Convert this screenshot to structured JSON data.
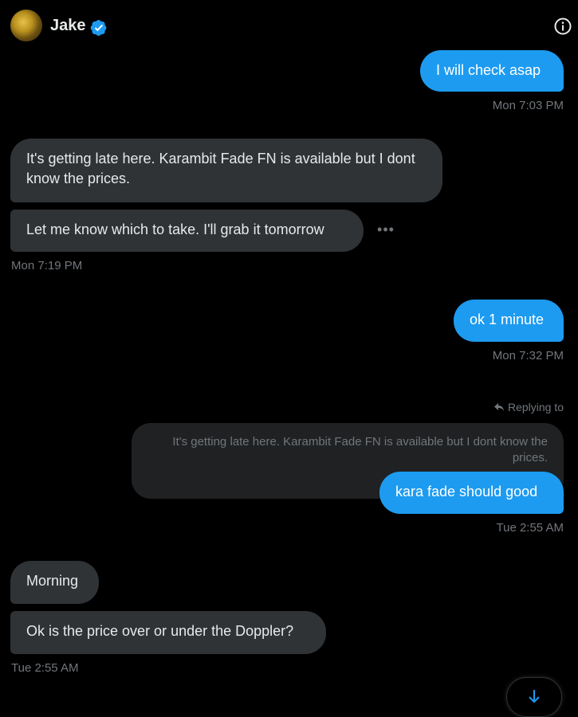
{
  "header": {
    "name": "Jake",
    "verified_icon": "verified-badge-icon",
    "info_icon": "info-icon"
  },
  "colors": {
    "background": "#000000",
    "outgoing_bubble": "#1d9bf0",
    "incoming_bubble": "#2f3336",
    "muted_text": "#71767b"
  },
  "messages": [
    {
      "from": "me",
      "text": "I will check asap"
    },
    {
      "from": "me",
      "timestamp": "Mon 7:03 PM"
    },
    {
      "from": "them",
      "text": "It's getting late here. Karambit Fade FN is available but I dont know the prices."
    },
    {
      "from": "them",
      "text": "Let me know which to take. I'll grab it tomorrow"
    },
    {
      "from": "them",
      "timestamp": "Mon 7:19 PM"
    },
    {
      "from": "me",
      "text": "ok 1 minute"
    },
    {
      "from": "me",
      "timestamp": "Mon 7:32 PM"
    },
    {
      "from": "me",
      "reply_label": "Replying to",
      "quoted": "It's getting late here. Karambit Fade FN is available but I dont know the prices.",
      "text": "kara fade should good"
    },
    {
      "from": "me",
      "timestamp": "Tue 2:55 AM"
    },
    {
      "from": "them",
      "text": "Morning"
    },
    {
      "from": "them",
      "text": "Ok is the price over or under the Doppler?"
    },
    {
      "from": "them",
      "timestamp": "Tue 2:55 AM"
    }
  ],
  "more_icon": "more-dots-icon",
  "scroll_icon": "arrow-down-icon"
}
